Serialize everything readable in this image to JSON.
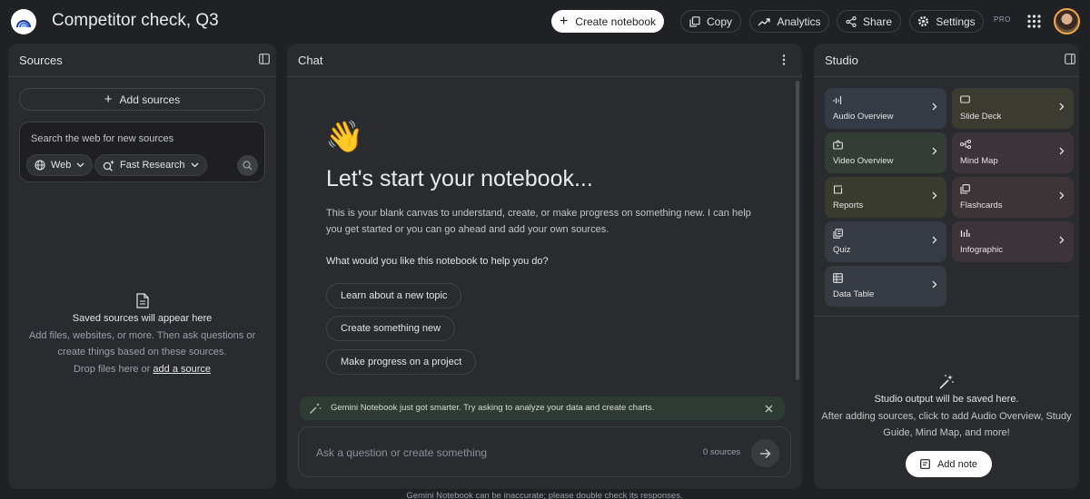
{
  "header": {
    "notebook_title": "Competitor check, Q3",
    "create_label": "Create notebook",
    "copy_label": "Copy",
    "analytics_label": "Analytics",
    "share_label": "Share",
    "settings_label": "Settings",
    "pro_badge": "PRO"
  },
  "sources": {
    "title": "Sources",
    "add_label": "Add sources",
    "search_placeholder": "Search the web for new sources",
    "web_chip": "Web",
    "research_chip": "Fast Research",
    "empty_title": "Saved sources will appear here",
    "empty_line1": "Add files, websites, or more. Then ask questions or",
    "empty_line2": "create things based on these sources.",
    "empty_line3_prefix": "Drop files here or",
    "empty_link": "add a source"
  },
  "chat": {
    "title": "Chat",
    "emoji": "👋",
    "heading": "Let's start your notebook...",
    "intro": "This is your blank canvas to understand, create, or make progress on something new. I can help you get started or you can go ahead and add your own sources.",
    "question": "What would you like this notebook to help you do?",
    "suggestions": [
      "Learn about a new topic",
      "Create something new",
      "Make progress on a project"
    ],
    "banner": "Gemini Notebook just got smarter. Try asking to analyze your data and create charts.",
    "input_placeholder": "Ask a question or create something",
    "source_count": "0 sources",
    "disclaimer": "Gemini Notebook can be inaccurate; please double check its responses."
  },
  "studio": {
    "title": "Studio",
    "tiles": [
      {
        "label": "Audio Overview",
        "icon": "audio-waveform-icon",
        "color": "#353b45"
      },
      {
        "label": "Slide Deck",
        "icon": "slides-icon",
        "color": "#3b3b30"
      },
      {
        "label": "Video Overview",
        "icon": "video-icon",
        "color": "#343c36"
      },
      {
        "label": "Mind Map",
        "icon": "mind-map-icon",
        "color": "#3d3439"
      },
      {
        "label": "Reports",
        "icon": "reports-icon",
        "color": "#3a3b2f"
      },
      {
        "label": "Flashcards",
        "icon": "flashcards-icon",
        "color": "#3c3436"
      },
      {
        "label": "Quiz",
        "icon": "quiz-icon",
        "color": "#353a43"
      },
      {
        "label": "Infographic",
        "icon": "infographic-icon",
        "color": "#3d3439"
      },
      {
        "label": "Data Table",
        "icon": "table-icon",
        "color": "#353a43"
      }
    ],
    "empty_title": "Studio output will be saved here.",
    "empty_line1": "After adding sources, click to add Audio Overview, Study",
    "empty_line2": "Guide, Mind Map, and more!",
    "add_note_label": "Add note"
  },
  "colors": {
    "background": "#202124",
    "panel": "#2a2b2e",
    "banner": "#2e3b34"
  }
}
